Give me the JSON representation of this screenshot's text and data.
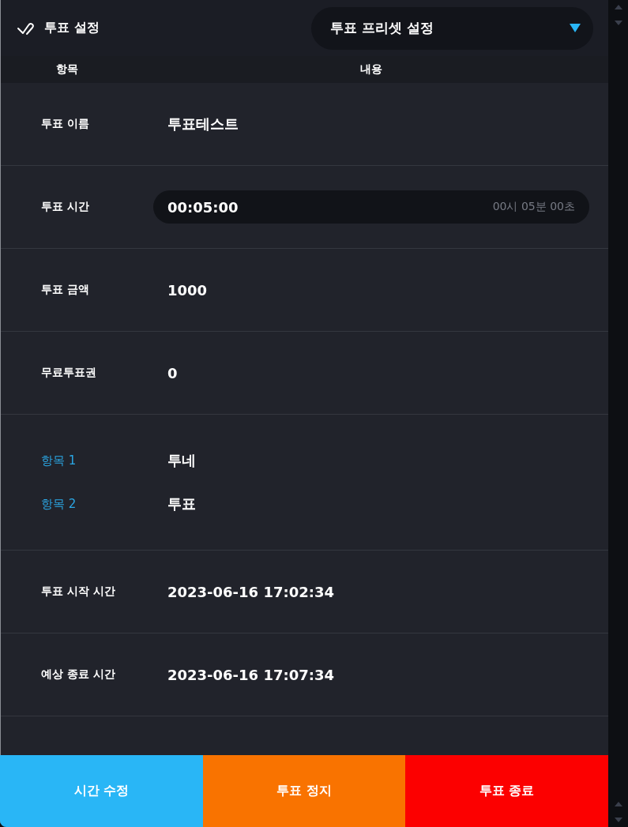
{
  "header": {
    "title": "투표 설정",
    "preset_dropdown": {
      "value": "투표 프리셋 설정"
    }
  },
  "columns": [
    "항목",
    "내용"
  ],
  "rows": [
    {
      "kind": "text",
      "label": "투표 이름",
      "value": "투표테스트"
    },
    {
      "kind": "time",
      "label": "투표 시간",
      "value": "00:05:00",
      "hint": "00시 05분 00초"
    },
    {
      "kind": "text",
      "label": "투표 금액",
      "value": "1000"
    },
    {
      "kind": "text",
      "label": "무료투표권",
      "value": "0"
    },
    {
      "kind": "options",
      "items": [
        {
          "label": "항목 1",
          "value": "투네"
        },
        {
          "label": "항목 2",
          "value": "투표"
        }
      ]
    },
    {
      "kind": "text",
      "label": "투표 시작 시간",
      "value": "2023-06-16 17:02:34"
    },
    {
      "kind": "text",
      "label": "예상 종료 시간",
      "value": "2023-06-16 17:07:34"
    }
  ],
  "buttons": [
    {
      "label": "시간 수정",
      "color": "#29b6f6"
    },
    {
      "label": "투표 정지",
      "color": "#f97300"
    },
    {
      "label": "투표 종료",
      "color": "#fc0000"
    }
  ]
}
